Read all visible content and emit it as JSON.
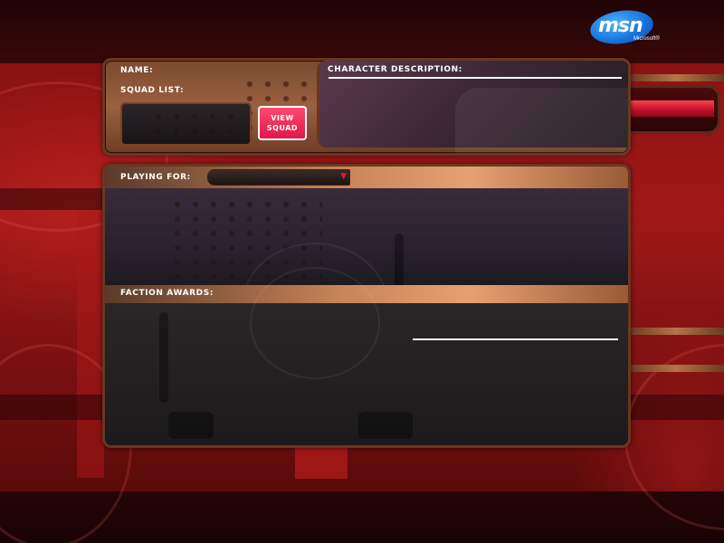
{
  "logo": {
    "text": "msn",
    "subtext": "Microsoft®",
    "color": "#1670d8"
  },
  "profile_panel": {
    "name_label": "NAME:",
    "squad_list_label": "SQUAD LIST:",
    "view_squad_button": "VIEW\nSQUAD",
    "character_description_label": "CHARACTER DESCRIPTION:"
  },
  "faction_panel": {
    "playing_for_label": "PLAYING FOR:",
    "playing_for_value": "",
    "faction_awards_label": "FACTION AWARDS:"
  },
  "colors": {
    "accent_button": "#e01848",
    "panel_border": "#6a3622",
    "background_red": "#a01818"
  },
  "icons": {
    "dropdown": "triangle-down-icon",
    "logo": "msn-butterfly-logo"
  }
}
